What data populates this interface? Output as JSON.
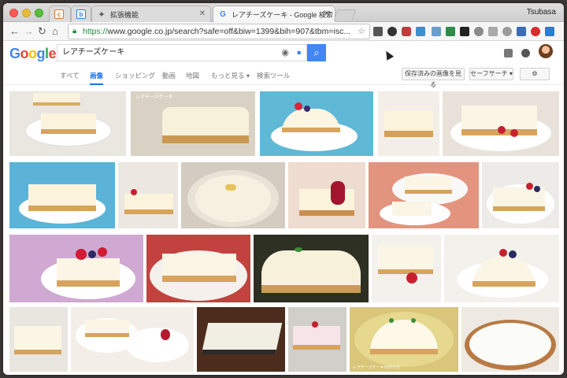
{
  "browser": {
    "user": "Tsubasa",
    "tabs": [
      {
        "label": "",
        "icon": "extension-c-icon"
      },
      {
        "label": "",
        "icon": "extension-b-icon"
      },
      {
        "label": "拡張機能",
        "icon": "puzzle-icon"
      },
      {
        "label": "レアチーズケーキ - Google 検索",
        "icon": "google-g-icon"
      }
    ],
    "url_secure": "https://",
    "url_rest": "www.google.co.jp/search?safe=off&biw=1399&bih=907&tbm=isc..."
  },
  "google": {
    "logo": [
      "G",
      "o",
      "o",
      "g",
      "l",
      "e"
    ],
    "logo_colors": [
      "#4285f4",
      "#ea4335",
      "#fbbc05",
      "#4285f4",
      "#34a853",
      "#ea4335"
    ],
    "query": "レアチーズケーキ",
    "tabs": [
      "すべて",
      "画像",
      "ショッピング",
      "動画",
      "地図",
      "もっと見る ▾",
      "検索ツール"
    ],
    "active_tab": "画像",
    "saved_images_label": "保存済みの画像を見る",
    "safesearch_label": "セーフサーチ ▾"
  },
  "results": {
    "watermark_1": "レアチーズケーキ",
    "watermark_2": "レアチーズケーキの作り方",
    "image_count": 24
  },
  "colors": {
    "accent": "#4285f4",
    "active_tab": "#1a73e8"
  }
}
